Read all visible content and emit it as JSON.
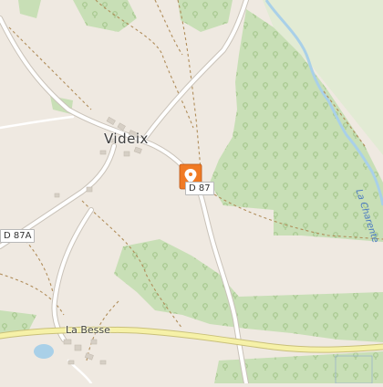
{
  "map": {
    "places": {
      "videix": "Videix",
      "la_besse": "La Besse"
    },
    "roads": {
      "d87_east": "D 87",
      "d87a": "D 87A"
    },
    "river": "La Charente",
    "marker": {
      "icon": "map-pin-icon",
      "color": "#f07a24"
    },
    "colors": {
      "land": "#efe9e1",
      "forest": "#c8dfb6",
      "meadow": "#e2ebd4",
      "water": "#a9d0e8",
      "major_road": "#f6f1a8",
      "minor_road": "#ffffff",
      "building": "#d6cfc5"
    }
  }
}
